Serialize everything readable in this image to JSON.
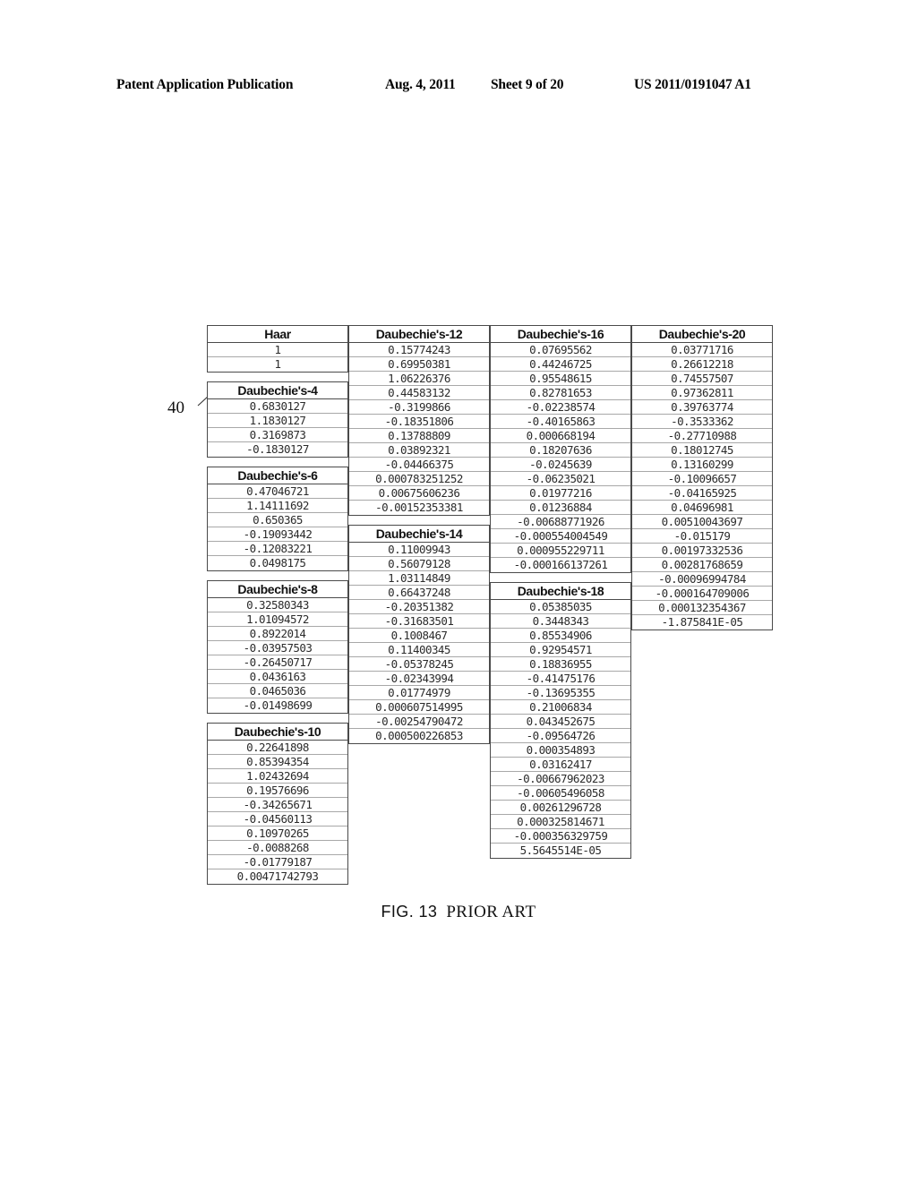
{
  "header": {
    "publication": "Patent Application Publication",
    "date": "Aug. 4, 2011",
    "sheet": "Sheet 9 of 20",
    "doc_number": "US 2011/0191047 A1"
  },
  "figure": {
    "reference_numeral": "40",
    "caption_number": "FIG. 13",
    "caption_note": "PRIOR ART"
  },
  "tables": [
    {
      "title": "Haar",
      "values": [
        "1",
        "1"
      ]
    },
    {
      "title": "Daubechie's-4",
      "values": [
        "0.6830127",
        "1.1830127",
        "0.3169873",
        "-0.1830127"
      ]
    },
    {
      "title": "Daubechie's-6",
      "values": [
        "0.47046721",
        "1.14111692",
        "0.650365",
        "-0.19093442",
        "-0.12083221",
        "0.0498175"
      ]
    },
    {
      "title": "Daubechie's-8",
      "values": [
        "0.32580343",
        "1.01094572",
        "0.8922014",
        "-0.03957503",
        "-0.26450717",
        "0.0436163",
        "0.0465036",
        "-0.01498699"
      ]
    },
    {
      "title": "Daubechie's-10",
      "values": [
        "0.22641898",
        "0.85394354",
        "1.02432694",
        "0.19576696",
        "-0.34265671",
        "-0.04560113",
        "0.10970265",
        "-0.0088268",
        "-0.01779187",
        "0.00471742793"
      ]
    },
    {
      "title": "Daubechie's-12",
      "values": [
        "0.15774243",
        "0.69950381",
        "1.06226376",
        "0.44583132",
        "-0.3199866",
        "-0.18351806",
        "0.13788809",
        "0.03892321",
        "-0.04466375",
        "0.000783251252",
        "0.00675606236",
        "-0.00152353381"
      ]
    },
    {
      "title": "Daubechie's-14",
      "values": [
        "0.11009943",
        "0.56079128",
        "1.03114849",
        "0.66437248",
        "-0.20351382",
        "-0.31683501",
        "0.1008467",
        "0.11400345",
        "-0.05378245",
        "-0.02343994",
        "0.01774979",
        "0.000607514995",
        "-0.00254790472",
        "0.000500226853"
      ]
    },
    {
      "title": "Daubechie's-16",
      "values": [
        "0.07695562",
        "0.44246725",
        "0.95548615",
        "0.82781653",
        "-0.02238574",
        "-0.40165863",
        "0.000668194",
        "0.18207636",
        "-0.0245639",
        "-0.06235021",
        "0.01977216",
        "0.01236884",
        "-0.00688771926",
        "-0.000554004549",
        "0.000955229711",
        "-0.000166137261"
      ]
    },
    {
      "title": "Daubechie's-18",
      "values": [
        "0.05385035",
        "0.3448343",
        "0.85534906",
        "0.92954571",
        "0.18836955",
        "-0.41475176",
        "-0.13695355",
        "0.21006834",
        "0.043452675",
        "-0.09564726",
        "0.000354893",
        "0.03162417",
        "-0.00667962023",
        "-0.00605496058",
        "0.00261296728",
        "0.000325814671",
        "-0.000356329759",
        "5.5645514E-05"
      ]
    },
    {
      "title": "Daubechie's-20",
      "values": [
        "0.03771716",
        "0.26612218",
        "0.74557507",
        "0.97362811",
        "0.39763774",
        "-0.3533362",
        "-0.27710988",
        "0.18012745",
        "0.13160299",
        "-0.10096657",
        "-0.04165925",
        "0.04696981",
        "0.00510043697",
        "-0.015179",
        "0.00197332536",
        "0.00281768659",
        "-0.00096994784",
        "-0.000164709006",
        "0.000132354367",
        "-1.875841E-05"
      ]
    }
  ],
  "layout": {
    "columns": [
      {
        "table_indices": [
          0,
          1,
          2,
          3,
          4
        ]
      },
      {
        "table_indices": [
          5,
          6
        ]
      },
      {
        "table_indices": [
          7,
          8
        ]
      },
      {
        "table_indices": [
          9
        ]
      }
    ]
  }
}
